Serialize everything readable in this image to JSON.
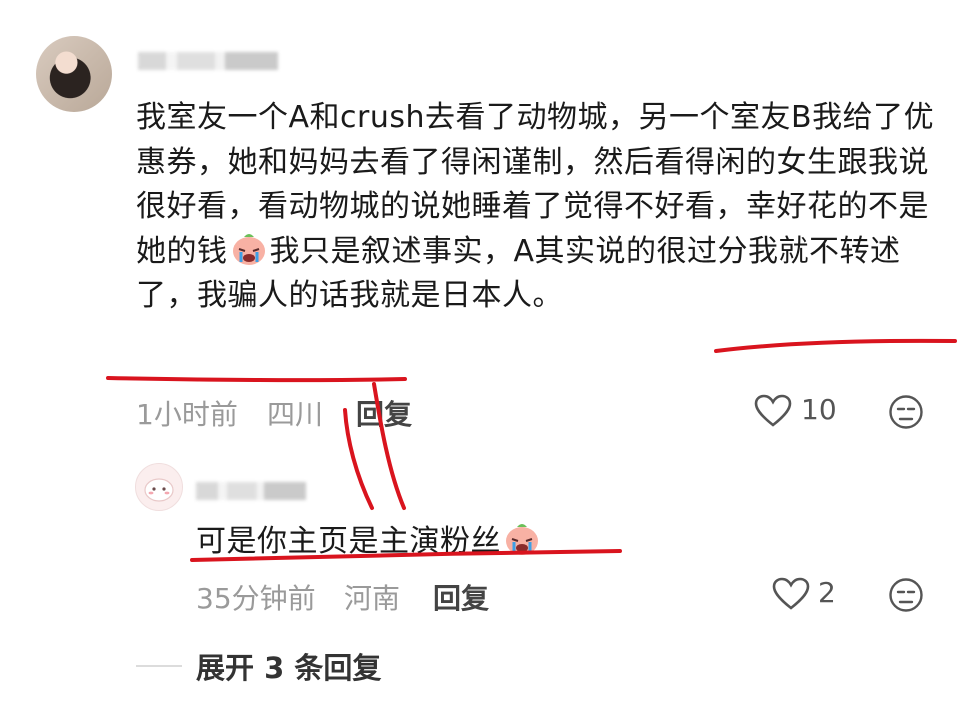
{
  "comment": {
    "text_before_emoji": "我室友一个A和crush去看了动物城，另一个室友B我给了优惠券，她和妈妈去看了得闲谨制，然后看得闲的女生跟我说很好看，看动物城的说她睡着了觉得不好看，幸好花的不是她的钱",
    "text_after_emoji": "我只是叙述事实，A其实说的很过分我就不转述了，我骗人的话我就是日本人。",
    "time": "1小时前",
    "location": "四川",
    "reply_label": "回复",
    "likes": "10"
  },
  "reply": {
    "text": "可是你主页是主演粉丝",
    "time": "35分钟前",
    "location": "河南",
    "reply_label": "回复",
    "likes": "2"
  },
  "expand_label": "展开 3 条回复",
  "colors": {
    "annotation_red": "#d9141e",
    "meta_gray": "#9a9a9a"
  },
  "icons": [
    "heart-outline-icon",
    "dislike-face-icon",
    "crying-emoji-icon"
  ]
}
